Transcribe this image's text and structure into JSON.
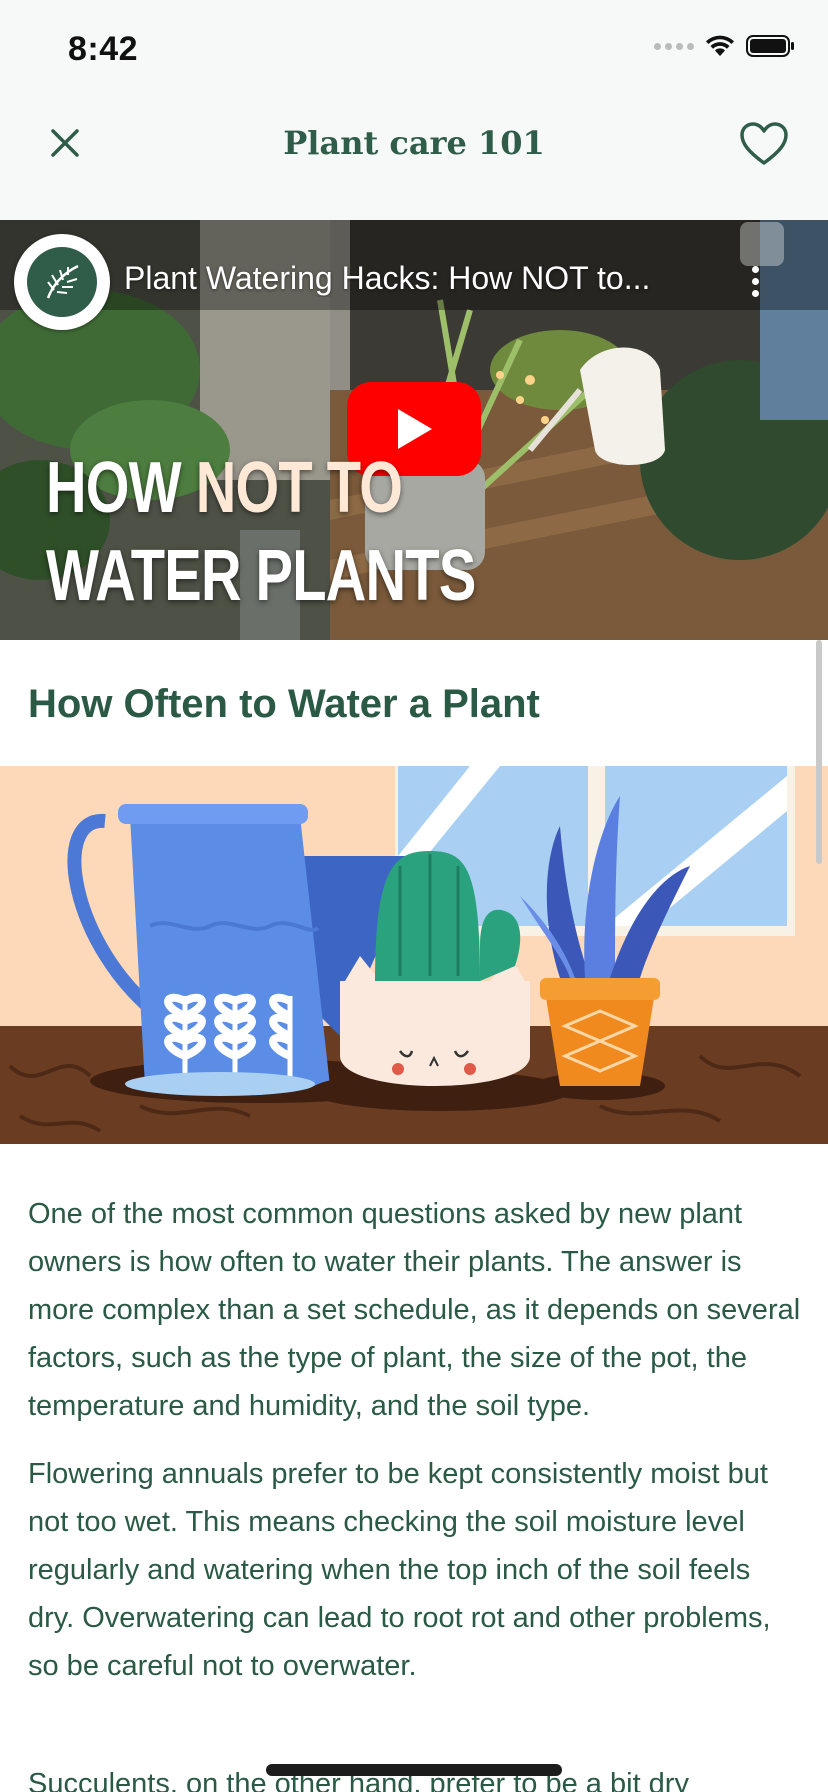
{
  "status_bar": {
    "time": "8:42",
    "icons": [
      "signal-icon",
      "wifi-icon",
      "battery-icon"
    ]
  },
  "header": {
    "title": "Plant care 101",
    "close_icon": "close-icon",
    "favorite_icon": "heart-icon"
  },
  "video": {
    "title": "Plant Watering Hacks: How NOT to...",
    "overlay_line1_a": "HOW ",
    "overlay_line1_b": "NOT TO",
    "overlay_line2": "WATER PLANTS",
    "play_icon": "play-icon",
    "more_icon": "more-vertical-icon",
    "channel_icon": "leaf-icon"
  },
  "article": {
    "heading": "How Often to Water a Plant",
    "paragraphs": [
      "One of the most common questions asked by new plant owners is how often to water their plants. The answer is more complex than a set schedule, as it depends on several factors, such as the type of plant, the size of the pot, the temperature and humidity, and the soil type.",
      "Flowering annuals prefer to be kept consistently moist but not too wet. This means checking the soil moisture level regularly and watering when the top inch of the soil feels dry. Overwatering can lead to root rot and other problems, so be careful not to overwater.",
      "Succulents, on the other hand, prefer to be a bit dry"
    ]
  },
  "colors": {
    "brand_green": "#2f5d4a",
    "youtube_red": "#ff0000",
    "status_bg": "#f7f8f8"
  }
}
